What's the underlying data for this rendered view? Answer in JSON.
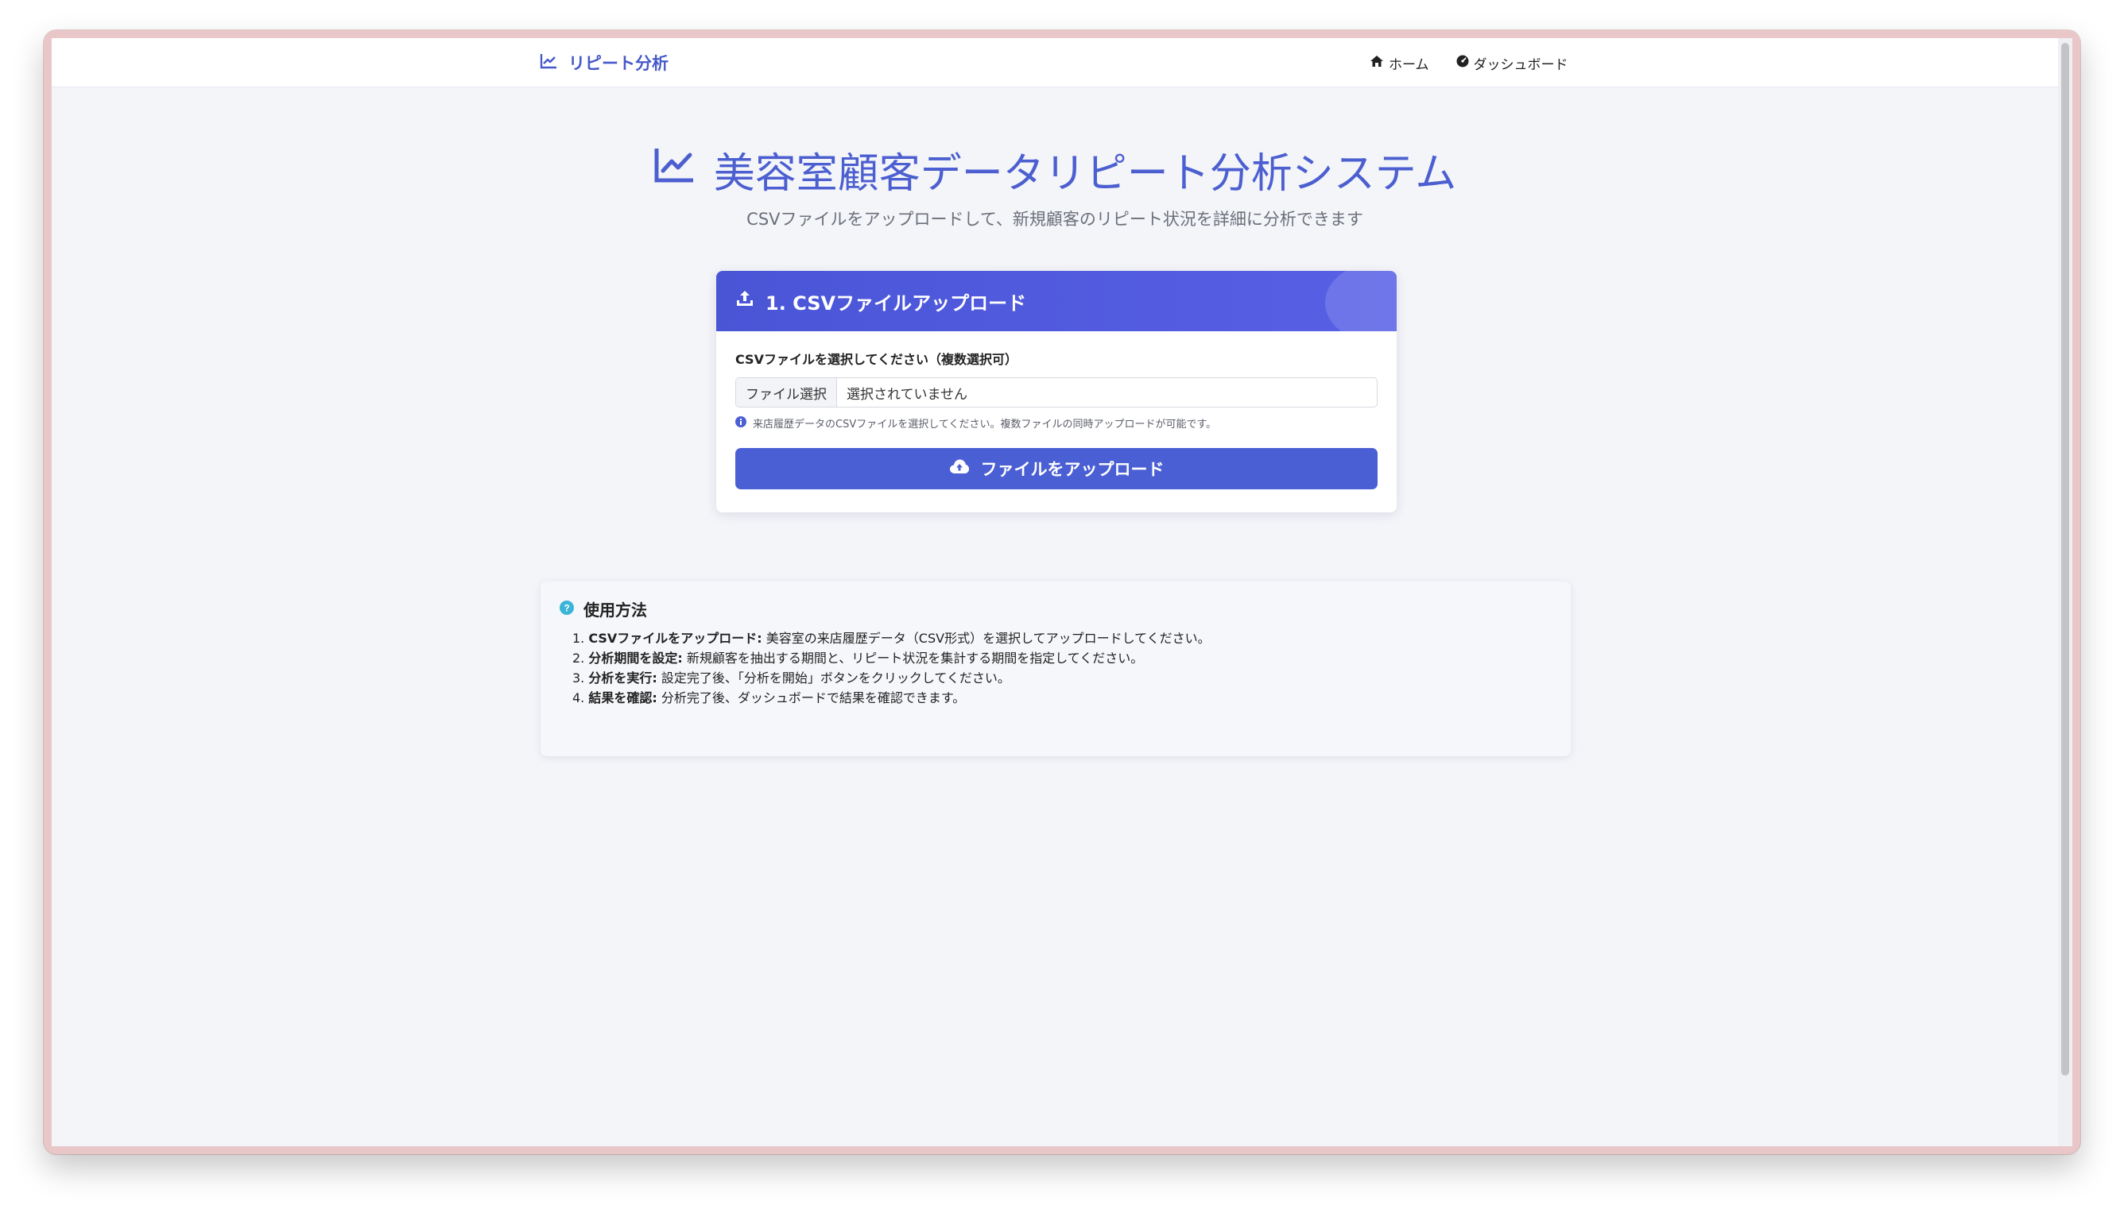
{
  "navbar": {
    "brand": "リピート分析",
    "links": [
      {
        "label": "ホーム",
        "icon": "home-icon"
      },
      {
        "label": "ダッシュボード",
        "icon": "dashboard-icon"
      }
    ]
  },
  "hero": {
    "title": "美容室顧客データリピート分析システム",
    "subtitle": "CSVファイルをアップロードして、新規顧客のリピート状況を詳細に分析できます"
  },
  "upload_card": {
    "title": "1. CSVファイルアップロード",
    "field_label": "CSVファイルを選択してください（複数選択可）",
    "file_button": "ファイル選択",
    "file_status": "選択されていません",
    "help": "来店履歴データのCSVファイルを選択してください。複数ファイルの同時アップロードが可能です。",
    "submit": "ファイルをアップロード"
  },
  "usage": {
    "title": "使用方法",
    "steps": [
      {
        "num": "1.",
        "label": "CSVファイルをアップロード:",
        "text": " 美容室の来店履歴データ（CSV形式）を選択してアップロードしてください。"
      },
      {
        "num": "2.",
        "label": "分析期間を設定:",
        "text": " 新規顧客を抽出する期間と、リピート状況を集計する期間を指定してください。"
      },
      {
        "num": "3.",
        "label": "分析を実行:",
        "text": " 設定完了後、「分析を開始」ボタンをクリックしてください。"
      },
      {
        "num": "4.",
        "label": "結果を確認:",
        "text": " 分析完了後、ダッシュボードで結果を確認できます。"
      }
    ]
  },
  "colors": {
    "primary": "#4b5fd4",
    "background": "#f4f5f9",
    "info": "#3bb4d8"
  }
}
